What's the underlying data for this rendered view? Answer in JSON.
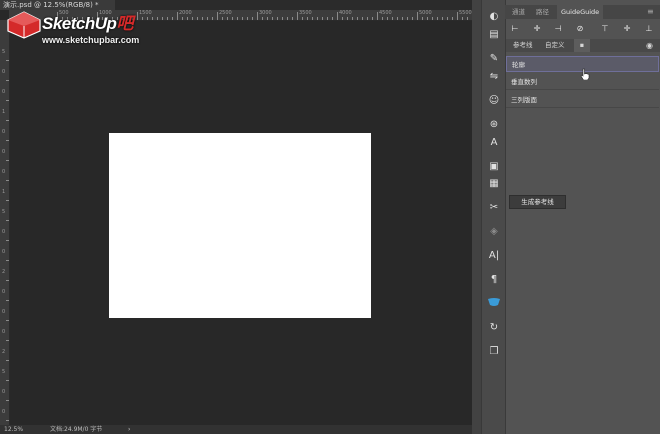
{
  "document": {
    "tab_title": "演示.psd @ 12.5%(RGB/8) *",
    "zoom": "12.5%",
    "status_text": "文档:24.9M/0 字节"
  },
  "rulers": {
    "top_labels": [
      "500",
      "1000",
      "1500",
      "2000",
      "2500",
      "3000",
      "3500",
      "4000",
      "4500",
      "5000",
      "5500",
      "6000"
    ],
    "left_labels": [
      "5",
      "0",
      "0",
      "1",
      "0",
      "0",
      "0",
      "1",
      "5",
      "0",
      "0",
      "2",
      "0",
      "0",
      "0",
      "2",
      "5",
      "0",
      "0",
      "3"
    ]
  },
  "watermark": {
    "brand": "SketchUp",
    "brand_suffix": "吧",
    "url": "www.sketchupbar.com",
    "accent": "#d42a2a"
  },
  "panel": {
    "tabs": [
      "通道",
      "路径",
      "GuideGuide"
    ],
    "active_tab": "GuideGuide",
    "sub_tabs": [
      "参考线",
      "自定义"
    ],
    "saved_guides": [
      "轮廓",
      "垂直数列",
      "三列版面"
    ],
    "generate_label": "生成参考线"
  },
  "tools": [
    "color-wheel-icon",
    "properties-icon",
    "brush-icon",
    "adjustments-icon",
    "people-icon",
    "clone-source-icon",
    "character-style-icon",
    "notes-icon",
    "layer-comps-icon",
    "tool-presets-icon",
    "3d-icon",
    "character-icon",
    "paragraph-icon",
    "libraries-icon",
    "history-icon",
    "layers-icon"
  ],
  "colors": {
    "panel_bg": "#535353",
    "canvas_bg": "#282828",
    "selected_row": "#5b5b68"
  }
}
